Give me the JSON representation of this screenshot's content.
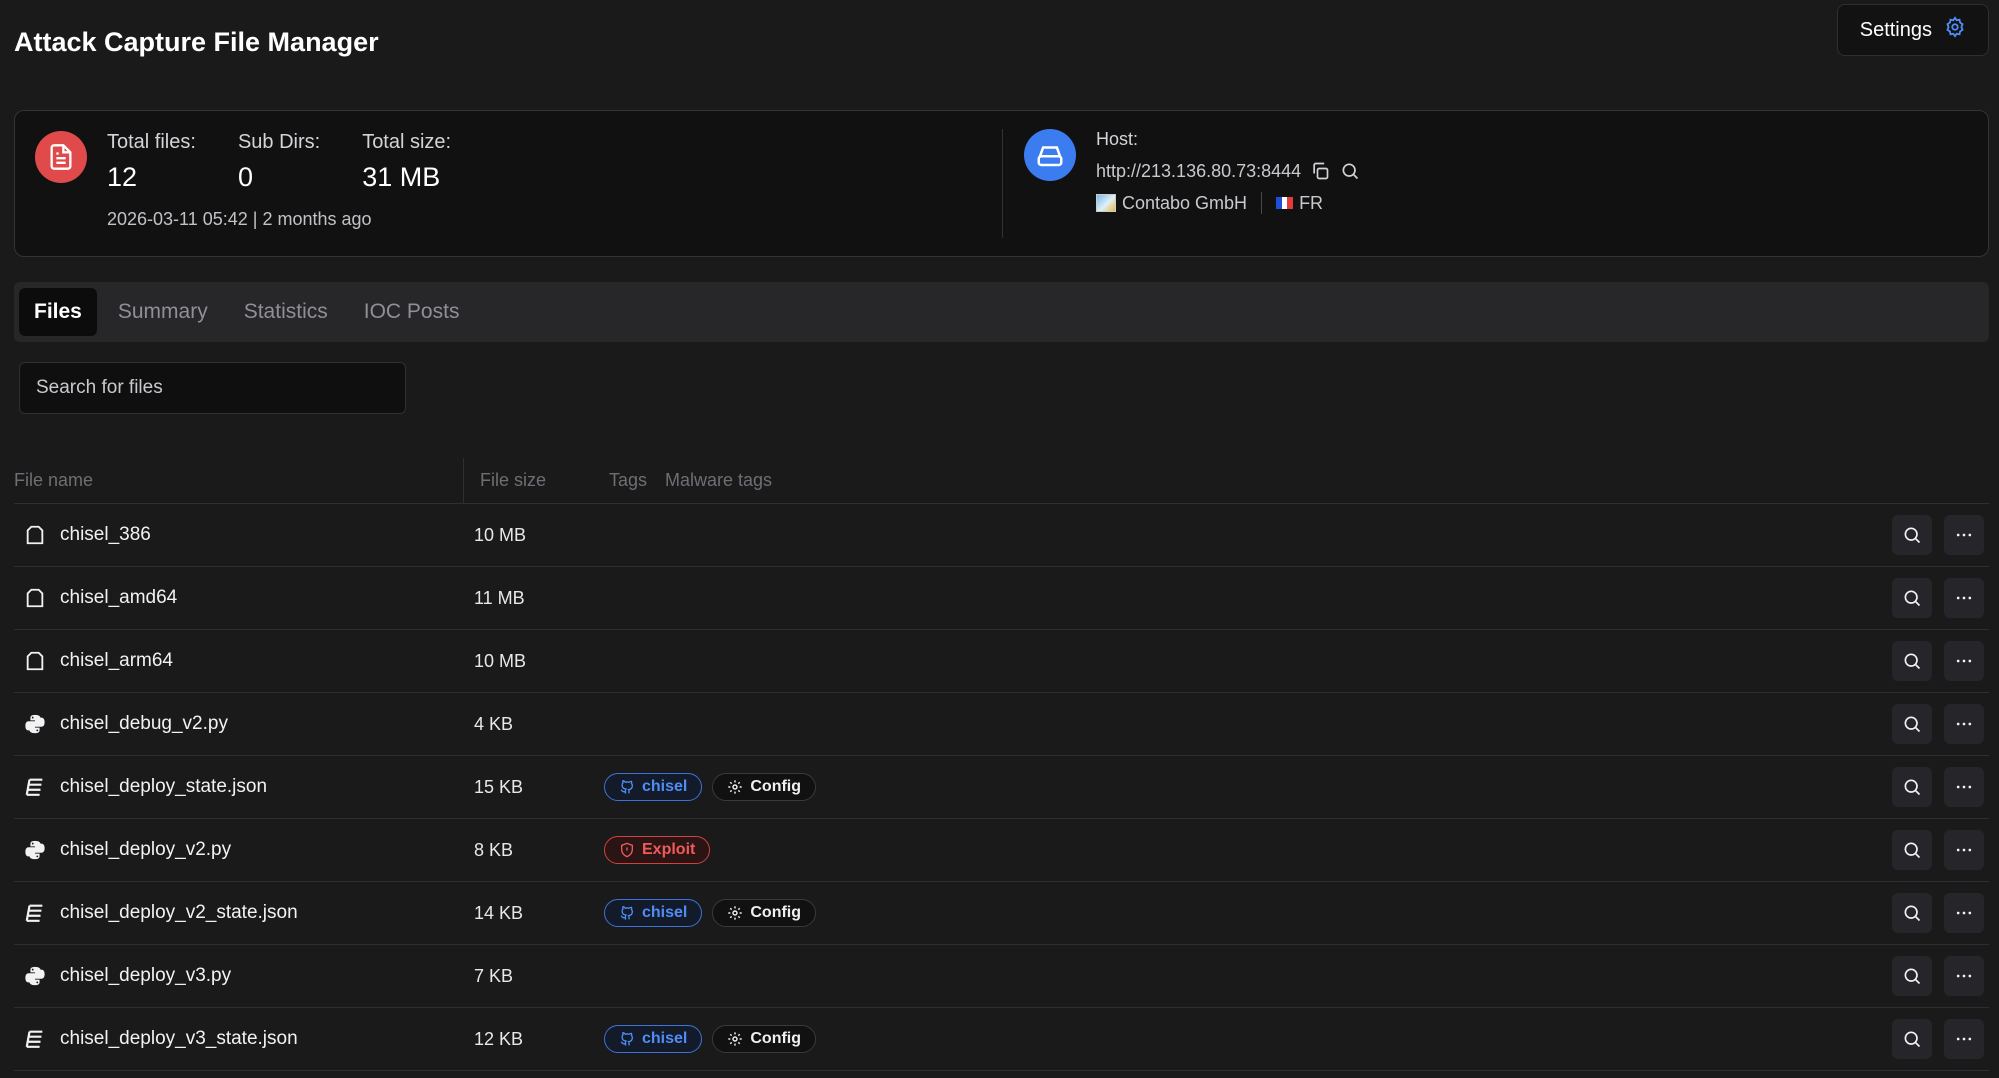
{
  "header": {
    "title": "Attack Capture File Manager",
    "settings_label": "Settings"
  },
  "summary": {
    "total_files_label": "Total files:",
    "total_files_value": "12",
    "sub_dirs_label": "Sub Dirs:",
    "sub_dirs_value": "0",
    "total_size_label": "Total size:",
    "total_size_value": "31 MB",
    "date_text": "2026-03-11 05:42 | 2 months ago"
  },
  "host": {
    "label": "Host:",
    "url": "http://213.136.80.73:8444",
    "provider": "Contabo GmbH",
    "country": "FR"
  },
  "tabs": [
    {
      "label": "Files",
      "active": true
    },
    {
      "label": "Summary",
      "active": false
    },
    {
      "label": "Statistics",
      "active": false
    },
    {
      "label": "IOC Posts",
      "active": false
    }
  ],
  "search": {
    "placeholder": "Search for files"
  },
  "table": {
    "columns": {
      "name": "File name",
      "size": "File size",
      "tags": "Tags",
      "malware_tags": "Malware tags"
    },
    "rows": [
      {
        "name": "chisel_386",
        "size": "10 MB",
        "icon": "file-icon",
        "tags": []
      },
      {
        "name": "chisel_amd64",
        "size": "11 MB",
        "icon": "file-icon",
        "tags": []
      },
      {
        "name": "chisel_arm64",
        "size": "10 MB",
        "icon": "file-icon",
        "tags": []
      },
      {
        "name": "chisel_debug_v2.py",
        "size": "4 KB",
        "icon": "python-icon",
        "tags": []
      },
      {
        "name": "chisel_deploy_state.json",
        "size": "15 KB",
        "icon": "json-icon",
        "tags": [
          {
            "label": "chisel",
            "kind": "github"
          },
          {
            "label": "Config",
            "kind": "config"
          }
        ]
      },
      {
        "name": "chisel_deploy_v2.py",
        "size": "8 KB",
        "icon": "python-icon",
        "tags": [
          {
            "label": "Exploit",
            "kind": "exploit"
          }
        ]
      },
      {
        "name": "chisel_deploy_v2_state.json",
        "size": "14 KB",
        "icon": "json-icon",
        "tags": [
          {
            "label": "chisel",
            "kind": "github"
          },
          {
            "label": "Config",
            "kind": "config"
          }
        ]
      },
      {
        "name": "chisel_deploy_v3.py",
        "size": "7 KB",
        "icon": "python-icon",
        "tags": []
      },
      {
        "name": "chisel_deploy_v3_state.json",
        "size": "12 KB",
        "icon": "json-icon",
        "tags": [
          {
            "label": "chisel",
            "kind": "github"
          },
          {
            "label": "Config",
            "kind": "config"
          }
        ]
      }
    ]
  },
  "colors": {
    "background": "#1a1a1b",
    "file_badge": "#e14a4a",
    "host_badge": "#3b7cf0",
    "tag_blue": "#4f8df5",
    "tag_red": "#ef5b5b"
  }
}
